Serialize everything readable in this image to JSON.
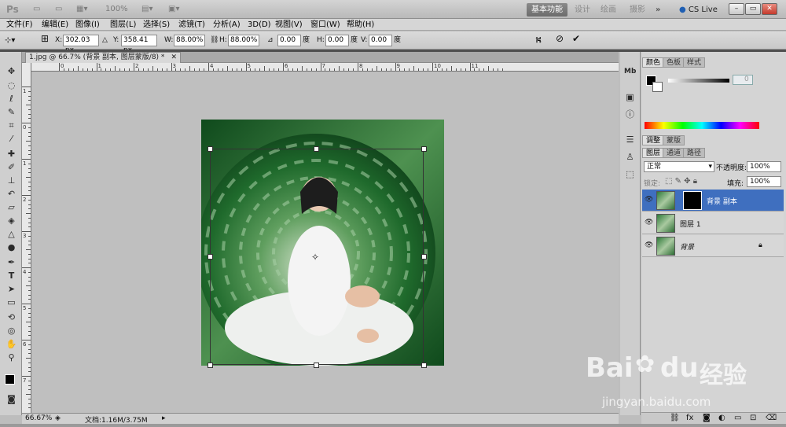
{
  "titlebar": {
    "logo": "Ps",
    "zoom": "100%",
    "workspaces": [
      "基本功能",
      "设计",
      "绘画",
      "摄影"
    ],
    "more": "»",
    "cslive": "CS Live"
  },
  "menu": [
    "文件(F)",
    "编辑(E)",
    "图像(I)",
    "图层(L)",
    "选择(S)",
    "滤镜(T)",
    "分析(A)",
    "3D(D)",
    "视图(V)",
    "窗口(W)",
    "帮助(H)"
  ],
  "options": {
    "x_label": "X:",
    "x_value": "302.03 px",
    "y_label": "Y:",
    "y_value": "358.41 px",
    "w_label": "W:",
    "w_value": "88.00%",
    "h_label": "H:",
    "h_value": "88.00%",
    "angle_value": "0.00",
    "angle_unit": "度",
    "hskew_label": "H:",
    "hskew_value": "0.00",
    "hskew_unit": "度",
    "vskew_label": "V:",
    "vskew_value": "0.00",
    "vskew_unit": "度"
  },
  "document": {
    "tab_title": "1.jpg @ 66.7% (背景 副本, 图层蒙版/8) *",
    "ruler_top": [
      "0",
      "1",
      "2",
      "3",
      "4",
      "5",
      "6",
      "7",
      "8",
      "9",
      "10",
      "11"
    ],
    "ruler_left": [
      "1",
      "0",
      "1",
      "2",
      "3",
      "4",
      "5",
      "6",
      "7"
    ]
  },
  "status": {
    "zoom": "66.67%",
    "doc_info": "文档:1.16M/3.75M"
  },
  "panels": {
    "color_tabs": [
      "颜色",
      "色板",
      "样式"
    ],
    "color_value": "0",
    "adjust_tabs": [
      "调整",
      "蒙版"
    ],
    "layer_tabs": [
      "图层",
      "通道",
      "路径"
    ],
    "blend_mode": "正常",
    "opacity_label": "不透明度:",
    "opacity_value": "100%",
    "lock_label": "锁定:",
    "fill_label": "填充:",
    "fill_value": "100%",
    "layers": [
      {
        "name": "背景 副本",
        "selected": true
      },
      {
        "name": "图层 1",
        "selected": false
      },
      {
        "name": "背景",
        "selected": false
      }
    ]
  },
  "watermark": {
    "brand": "Bai",
    "brand2": "du",
    "cn": "经验",
    "url": "jingyan.baidu.com"
  }
}
